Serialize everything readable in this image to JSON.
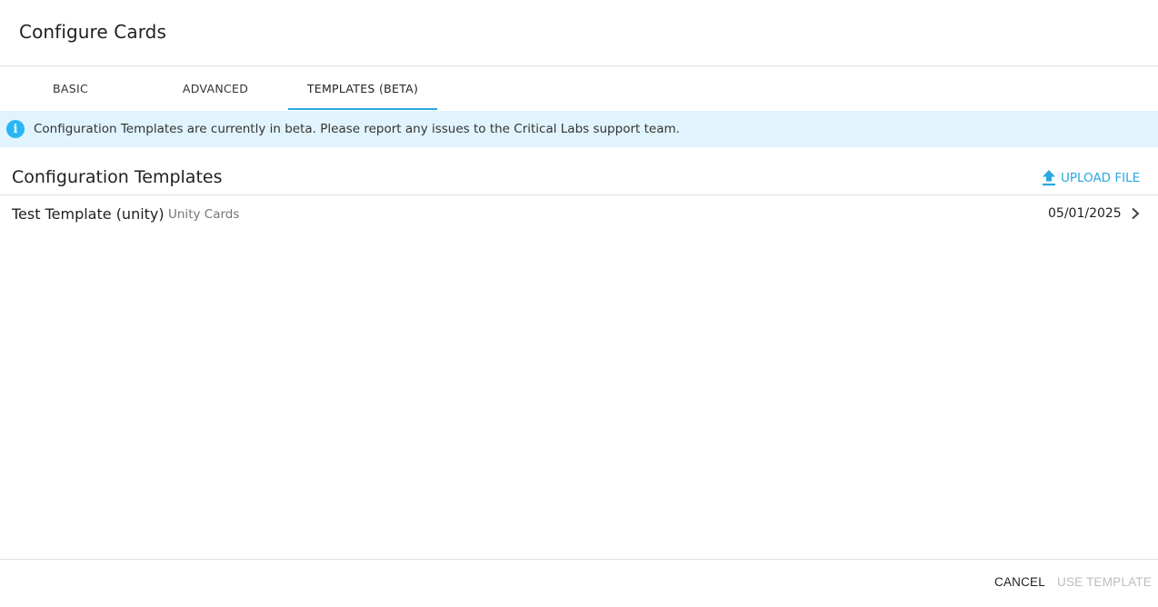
{
  "dialog": {
    "title": "Configure Cards"
  },
  "tabs": [
    {
      "label": "BASIC",
      "active": false
    },
    {
      "label": "ADVANCED",
      "active": false
    },
    {
      "label": "TEMPLATES (BETA)",
      "active": true
    }
  ],
  "banner": {
    "icon": "info-icon",
    "text": "Configuration Templates are currently in beta. Please report any issues to the Critical Labs support team."
  },
  "section": {
    "title": "Configuration Templates",
    "upload_label": "UPLOAD FILE",
    "upload_icon": "upload-icon"
  },
  "templates": [
    {
      "name": "Test Template (unity)",
      "type": "Unity Cards",
      "date": "05/01/2025",
      "icon": "chevron-right-icon"
    }
  ],
  "actions": {
    "cancel_label": "CANCEL",
    "use_label": "USE TEMPLATE",
    "use_disabled": true
  },
  "colors": {
    "accent": "#29a8e0",
    "banner_bg": "#e1f4fd",
    "divider": "#e0e0e0",
    "disabled_text": "#bdbdbd"
  }
}
